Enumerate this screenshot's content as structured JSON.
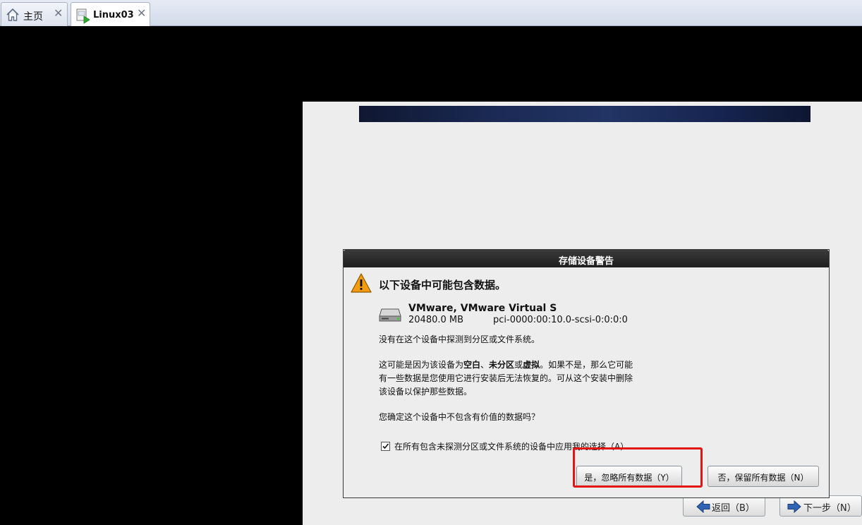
{
  "tabs": [
    {
      "label": "主页",
      "icon": "home-icon"
    },
    {
      "label": "Linux03",
      "icon": "vm-running-icon"
    }
  ],
  "installer": {
    "back_label": "返回（B）",
    "next_label": "下一步（N）"
  },
  "dialog": {
    "title": "存储设备警告",
    "heading": "以下设备中可能包含数据。",
    "device": {
      "name": "VMware, VMware Virtual S",
      "size": "20480.0 MB",
      "path": "pci-0000:00:10.0-scsi-0:0:0:0"
    },
    "no_fs_text": "没有在这个设备中探测到分区或文件系统。",
    "explain": {
      "part1": "这可能是因为该设备为",
      "blank": "空白",
      "sep1": "、",
      "unpartitioned": "未分区",
      "sep2": "或",
      "virtual": "虚拟",
      "part2": "。如果不是，那么它可能",
      "line2": "有一些数据是您使用它进行安装后无法恢复的。可从这个安装中删除",
      "line3": "该设备以保护那些数据。"
    },
    "confirm_question": "您确定这个设备中不包含有价值的数据吗？",
    "apply_all_label": "在所有包含未探测分区或文件系统的设备中应用我的选择（A）",
    "apply_all_checked": true,
    "yes_button": "是，忽略所有数据（Y）",
    "no_button": "否，保留所有数据（N）"
  },
  "colors": {
    "highlight": "#e31414",
    "warning": "#f39c12"
  }
}
